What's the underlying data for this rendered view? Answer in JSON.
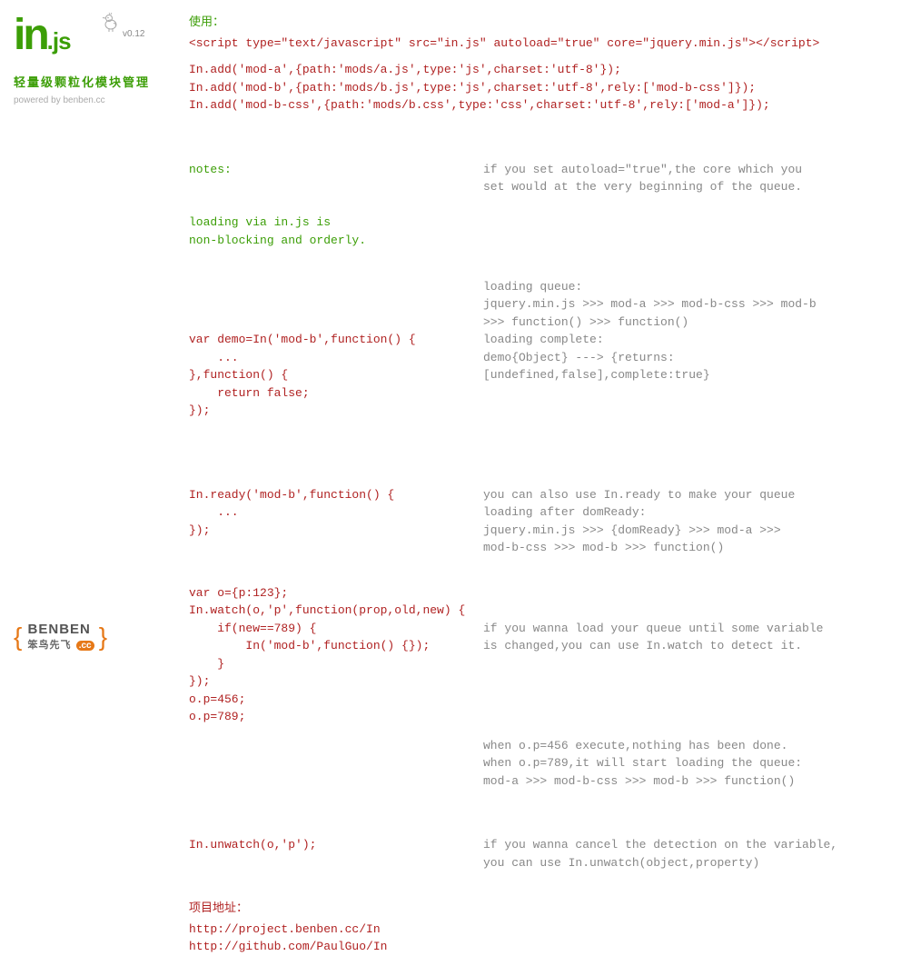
{
  "sidebar": {
    "logo_in": "in",
    "logo_js": ".js",
    "version": "v0.12",
    "subtitle_cn": "轻量级颗粒化模块管理",
    "subtitle_en": "powered by benben.cc"
  },
  "benben": {
    "name": "BENBEN",
    "cn": "笨鸟先飞",
    "cc": ".cc"
  },
  "usage": {
    "title": "使用：",
    "script_tag": "<script type=\"text/javascript\" src=\"in.js\" autoload=\"true\" core=\"jquery.min.js\"></script>",
    "adds": "In.add('mod-a',{path:'mods/a.js',type:'js',charset:'utf-8'});\nIn.add('mod-b',{path:'mods/b.js',type:'js',charset:'utf-8',rely:['mod-b-css']});\nIn.add('mod-b-css',{path:'mods/b.css',type:'css',charset:'utf-8',rely:['mod-a']});"
  },
  "notes": {
    "heading": "notes:",
    "text": "loading via in.js is\nnon-blocking and orderly."
  },
  "ex1": {
    "code": "var demo=In('mod-b',function() {\n    ...\n},function() {\n    return false;\n});",
    "desc_a": "if you set autoload=\"true\",the core which you\nset would at the very beginning of the queue.",
    "desc_b": "loading queue:\njquery.min.js >>> mod-a >>> mod-b-css >>> mod-b\n>>> function() >>> function()\nloading complete:\ndemo{Object} ---> {returns:[undefined,false],complete:true}"
  },
  "ex2": {
    "code": "In.ready('mod-b',function() {\n    ...\n});",
    "desc": "you can also use In.ready to make your queue\nloading after domReady:\njquery.min.js >>> {domReady} >>> mod-a >>>\nmod-b-css >>> mod-b >>> function()"
  },
  "ex3": {
    "code": "var o={p:123};\nIn.watch(o,'p',function(prop,old,new) {\n    if(new==789) {\n        In('mod-b',function() {});\n    }\n});\no.p=456;\no.p=789;",
    "desc_a": "if you wanna load your queue until some variable\nis changed,you can use In.watch to detect it.",
    "desc_b": "when o.p=456 execute,nothing has been done.\nwhen o.p=789,it will start loading the queue:\nmod-a >>> mod-b-css >>> mod-b >>> function()"
  },
  "ex4": {
    "code": "In.unwatch(o,'p');",
    "desc": "if you wanna cancel the detection on the variable,\nyou can use In.unwatch(object,property)"
  },
  "project": {
    "title": "项目地址：",
    "url1": "http://project.benben.cc/In",
    "url2": "http://github.com/PaulGuo/In"
  }
}
